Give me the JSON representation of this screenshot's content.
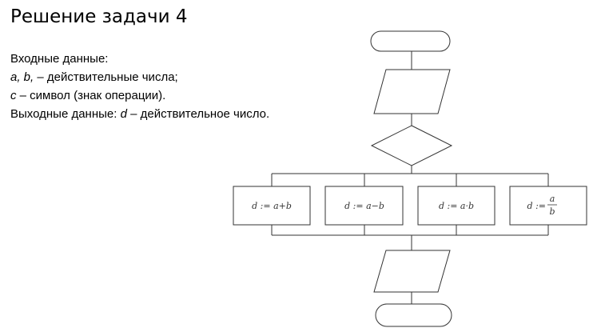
{
  "title": "Решение задачи 4",
  "input_header": "Входные данные:",
  "input_ab_vars": "a, b,",
  "input_ab_desc": " – действительные числа;",
  "input_c_var": "c",
  "input_c_desc": " – символ (знак операции).",
  "output_prefix": "Выходные данные: ",
  "output_var": "d",
  "output_desc": " – действительное число.",
  "branches": [
    {
      "lhs": "d",
      "op": " := ",
      "expr": "a+b"
    },
    {
      "lhs": "d",
      "op": " := ",
      "expr": "a−b"
    },
    {
      "lhs": "d",
      "op": " := ",
      "expr": "a·b"
    },
    {
      "lhs": "d",
      "op": " := ",
      "num": "a",
      "den": "b"
    }
  ]
}
